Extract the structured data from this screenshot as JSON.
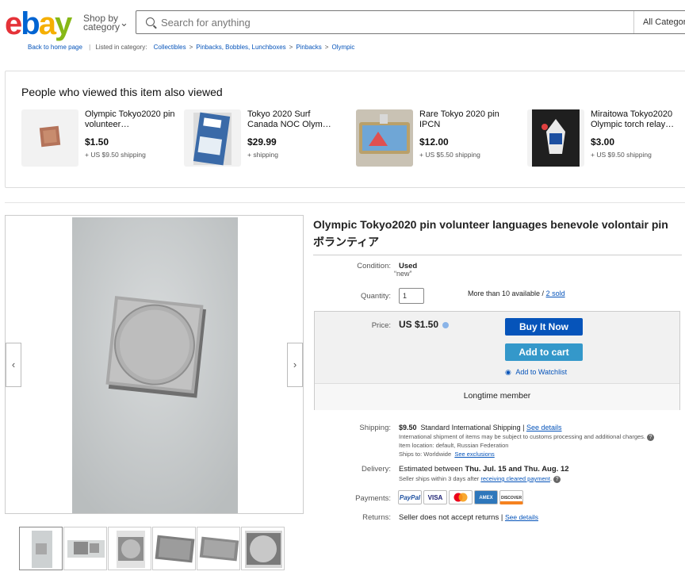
{
  "header": {
    "logo": {
      "e": "e",
      "b": "b",
      "a": "a",
      "y": "y"
    },
    "shop_by_line1": "Shop by",
    "shop_by_line2": "category",
    "search_placeholder": "Search for anything",
    "category_select": "All Categories"
  },
  "breadcrumb": {
    "back": "Back to home page",
    "listed_in": "Listed in category:",
    "items": [
      "Collectibles",
      "Pinbacks, Bobbles, Lunchboxes",
      "Pinbacks",
      "Olympic"
    ]
  },
  "also_viewed": {
    "title": "People who viewed this item also viewed",
    "items": [
      {
        "title": "Olympic Tokyo2020 pin volunteer…",
        "price": "$1.50",
        "shipping": "+ US $9.50 shipping"
      },
      {
        "title": "Tokyo 2020 Surf Canada NOC Olym…",
        "price": "$29.99",
        "shipping": "+ shipping"
      },
      {
        "title": "Rare Tokyo 2020 pin IPCN",
        "price": "$12.00",
        "shipping": "+ US $5.50 shipping"
      },
      {
        "title": "Miraitowa Tokyo2020 Olympic torch relay…",
        "price": "$3.00",
        "shipping": "+ US $9.50 shipping"
      }
    ]
  },
  "item": {
    "title": "Olympic Tokyo2020 pin volunteer languages benevole volontair pin ボランティア",
    "condition_label": "Condition:",
    "condition_value": "Used",
    "condition_note": "“new”",
    "quantity_label": "Quantity:",
    "quantity_value": "1",
    "available": "More than 10 available / ",
    "sold": "2 sold",
    "price_label": "Price:",
    "price": "US $1.50",
    "buy_now": "Buy It Now",
    "add_to_cart": "Add to cart",
    "add_to_watchlist": "Add to Watchlist",
    "seller_badge": "Longtime member"
  },
  "shipping": {
    "label": "Shipping:",
    "amount": "$9.50",
    "method": "Standard International Shipping | ",
    "see_details": "See details",
    "note": "International shipment of items may be subject to customs processing and additional charges.",
    "location": "Item location:  default, Russian Federation",
    "ships_to": "Ships to:  Worldwide",
    "see_exclusions": "See exclusions"
  },
  "delivery": {
    "label": "Delivery:",
    "estimated": "Estimated between ",
    "dates": "Thu. Jul. 15 and Thu. Aug. 12",
    "note": "Seller ships within 3 days after ",
    "note_link": "receiving cleared payment",
    "note_end": "."
  },
  "payments": {
    "label": "Payments:",
    "methods": [
      "PayPal",
      "VISA",
      "MasterCard",
      "AMEX",
      "DISCOVER"
    ]
  },
  "returns": {
    "label": "Returns:",
    "value": "Seller does not accept returns | ",
    "see_details": "See details"
  },
  "colors": {
    "accent_blue": "#0654ba",
    "cart_blue": "#3498ca"
  }
}
